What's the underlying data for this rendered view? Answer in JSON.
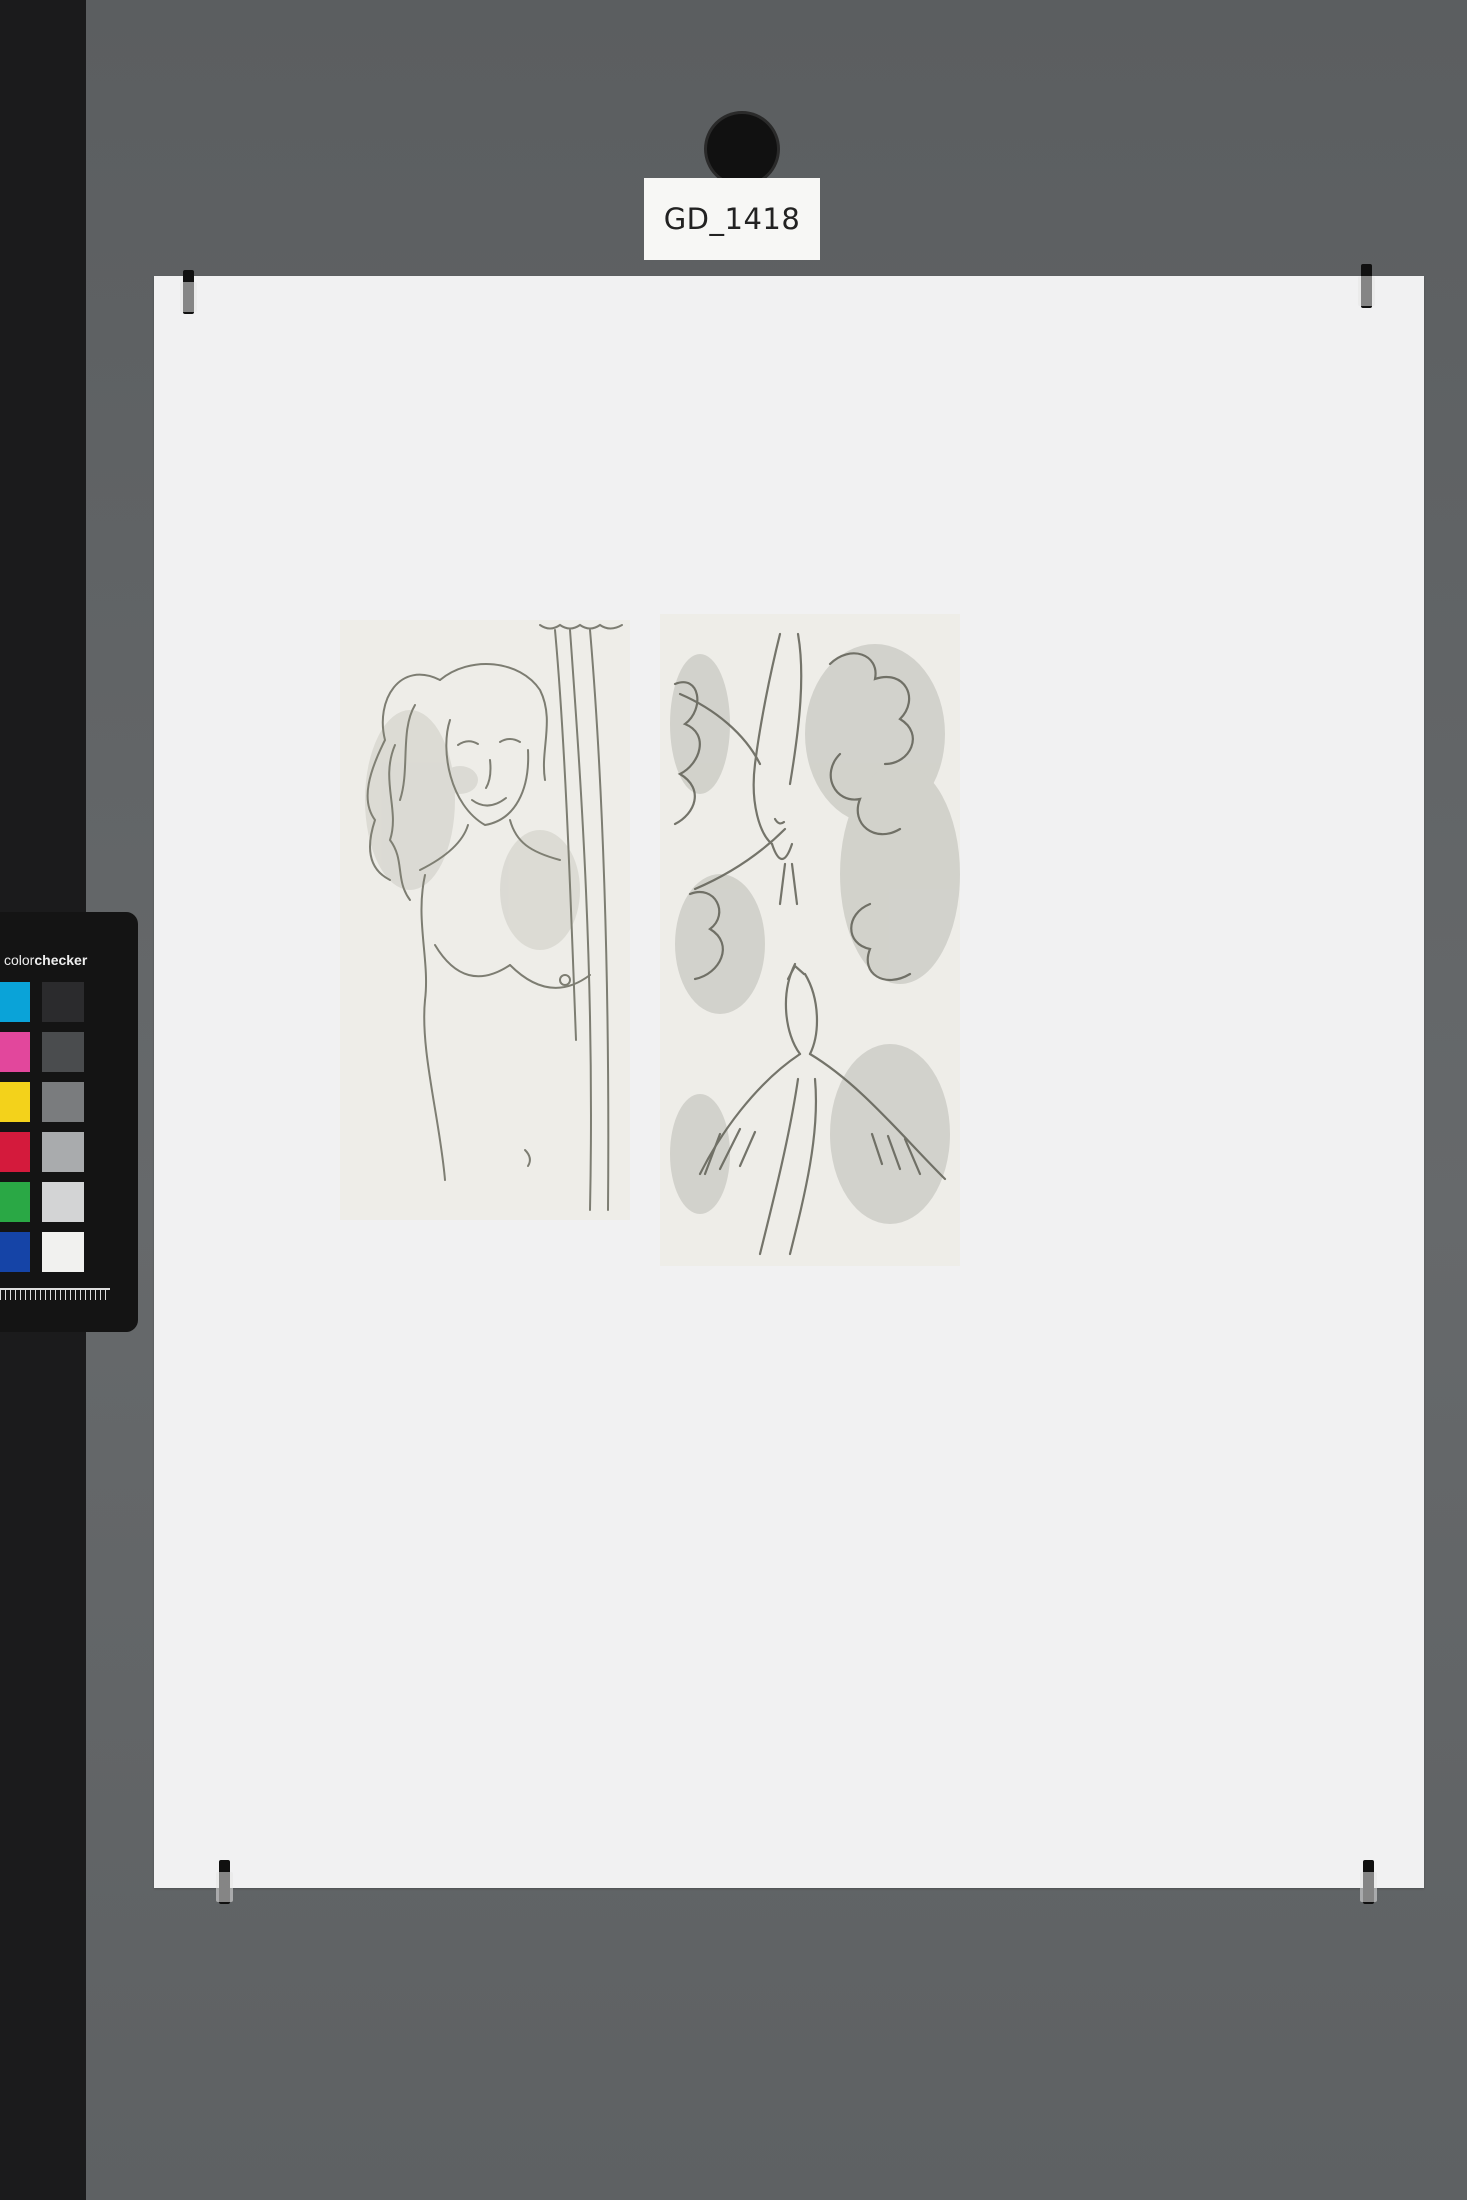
{
  "label": {
    "id_text": "GD_1418"
  },
  "colorchecker": {
    "brand_prefix": "color",
    "brand_suffix": "checker",
    "left_column_colors": [
      "#0aa3d8",
      "#e2479c",
      "#f3d21b",
      "#d41a3c",
      "#2aa845",
      "#1544a7"
    ],
    "right_column_colors": [
      "#2b2b2d",
      "#4a4c4e",
      "#7a7c7e",
      "#a9abad",
      "#d3d4d5",
      "#f1f1ef"
    ]
  },
  "artworks": [
    {
      "subject": "woman-portrait"
    },
    {
      "subject": "birds-and-clouds"
    }
  ]
}
